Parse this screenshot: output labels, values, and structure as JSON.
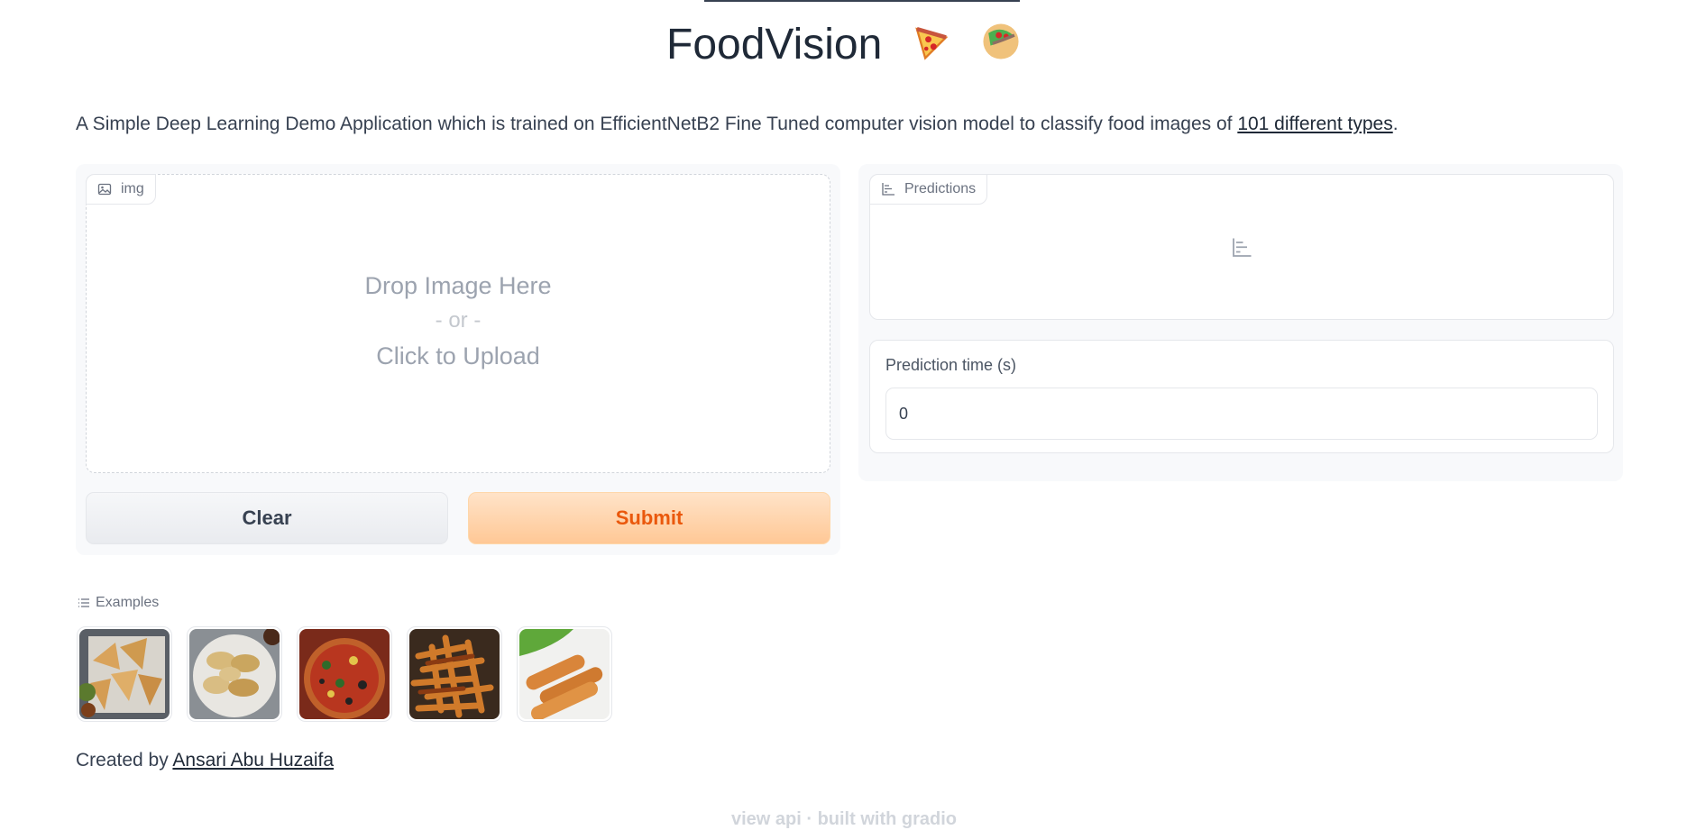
{
  "header": {
    "title": "FoodVision",
    "emoji": [
      "pizza-icon",
      "taco-icon"
    ]
  },
  "description": {
    "text": "A Simple Deep Learning Demo Application which is trained on EfficientNetB2 Fine Tuned computer vision model to classify food images of ",
    "link_text": "101 different types",
    "suffix": "."
  },
  "input_panel": {
    "label": "img",
    "drop_text": "Drop Image Here",
    "or_text": "- or -",
    "click_text": "Click to Upload",
    "clear_label": "Clear",
    "submit_label": "Submit"
  },
  "output_panel": {
    "predictions_label": "Predictions",
    "time_label": "Prediction time (s)",
    "time_value": "0"
  },
  "examples": {
    "label": "Examples",
    "items": [
      "samosa-thumbnail",
      "dumplings-thumbnail",
      "pizza-thumbnail",
      "fries-thumbnail",
      "spring-rolls-thumbnail"
    ]
  },
  "credit": {
    "prefix": "Created by ",
    "author": "Ansari Abu Huzaifa"
  },
  "footer": {
    "text": "view api  ·  built with gradio"
  },
  "colors": {
    "accent": "#ea580c",
    "submit_bg": "#ffc896",
    "panel_bg": "#f8f9fb"
  }
}
